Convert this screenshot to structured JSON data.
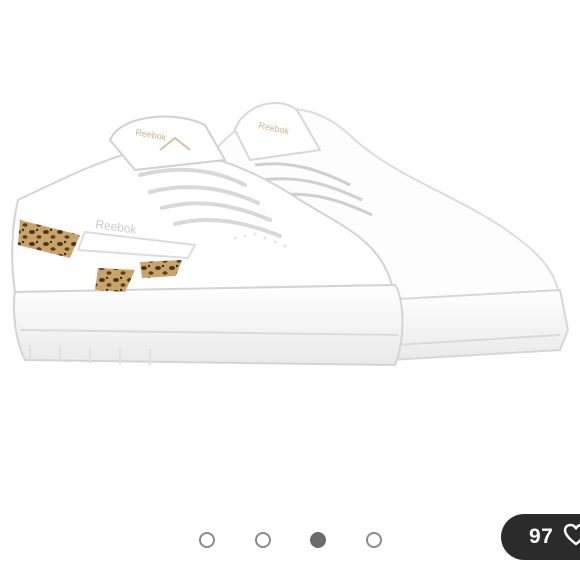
{
  "product": {
    "image_icon": "reebok-club-c-double-leopard-sneakers",
    "brand_text": "Reebok"
  },
  "carousel": {
    "dot_count": 4,
    "active_index": 2,
    "dot_color": "#8a8a8a",
    "active_color": "#6b6b6b"
  },
  "likes": {
    "count": "97",
    "icon": "heart-outline-icon",
    "badge_color": "#2b2b2b"
  }
}
